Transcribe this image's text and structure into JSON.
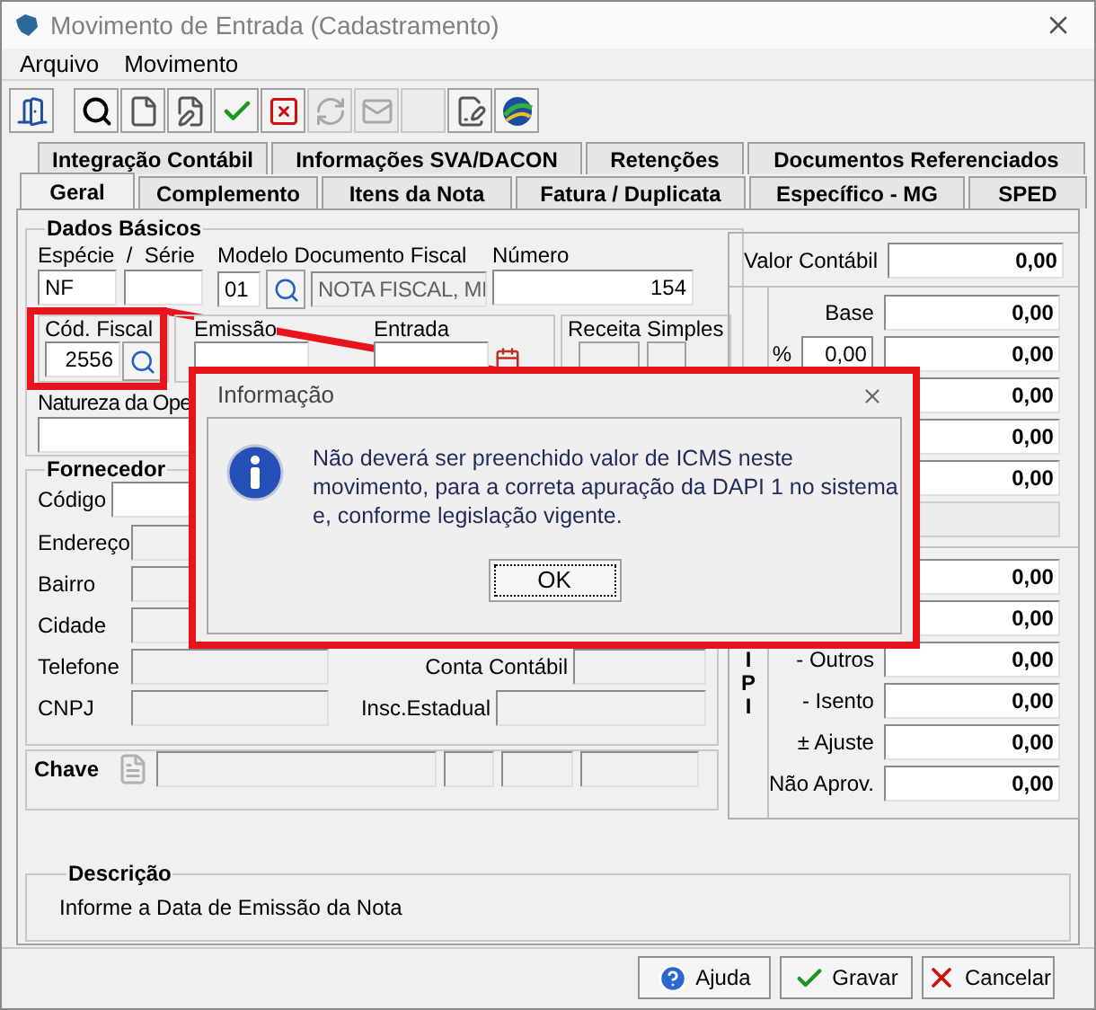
{
  "window": {
    "title": "Movimento de Entrada (Cadastramento)"
  },
  "menu": [
    {
      "label": "Arquivo"
    },
    {
      "label": "Movimento"
    }
  ],
  "toolbar": [
    {
      "kind": "exit",
      "disabled": false
    },
    {
      "kind": "search",
      "disabled": false
    },
    {
      "kind": "new",
      "disabled": false
    },
    {
      "kind": "edit",
      "disabled": false
    },
    {
      "kind": "confirm",
      "disabled": false
    },
    {
      "kind": "delete",
      "disabled": false
    },
    {
      "kind": "recycle",
      "disabled": true
    },
    {
      "kind": "mail",
      "disabled": true
    },
    {
      "kind": "blank",
      "disabled": true
    },
    {
      "kind": "sign",
      "disabled": false
    },
    {
      "kind": "nfe",
      "disabled": false
    }
  ],
  "tabs": [
    [
      {
        "label": "Integração Contábil",
        "selected": false
      },
      {
        "label": "Informações SVA/DACON",
        "selected": false
      },
      {
        "label": "Retenções",
        "selected": false
      },
      {
        "label": "Documentos Referenciados",
        "selected": false
      }
    ],
    [
      {
        "label": "Geral",
        "selected": true
      },
      {
        "label": "Complemento",
        "selected": false
      },
      {
        "label": "Itens da Nota",
        "selected": false
      },
      {
        "label": "Fatura / Duplicata",
        "selected": false
      },
      {
        "label": "Específico - MG",
        "selected": false
      },
      {
        "label": "SPED",
        "selected": false
      }
    ]
  ],
  "dados_basicos": {
    "title": "Dados Básicos",
    "especie_label": "Espécie  /  Série",
    "especie": {
      "value": "NF",
      "disabled": false
    },
    "serie": {
      "disabled": false
    },
    "modelo_label": "Modelo Documento Fiscal",
    "modelo": {
      "value": "01",
      "disabled": false
    },
    "modelo_desc": {
      "value": "NOTA FISCAL, MI",
      "disabled": true
    },
    "numero_label": "Número",
    "numero": {
      "value": "154",
      "disabled": false
    },
    "cod_fiscal_label": "Cód. Fiscal",
    "cod_fiscal": {
      "value": "2556",
      "disabled": false
    },
    "emissao_label": "Emissão",
    "emissao": {
      "disabled": false
    },
    "entrada_label": "Entrada",
    "entrada": {
      "disabled": false
    },
    "receita_label": "Receita Simples",
    "natureza_label": "Natureza da Ope",
    "natureza": {
      "disabled": false
    }
  },
  "fornecedor": {
    "title": "Fornecedor",
    "codigo_label": "Código",
    "codigo": {
      "disabled": false
    },
    "rows": [
      {
        "label": "Endereço",
        "disabled": true
      },
      {
        "label": "Bairro",
        "disabled": true
      },
      {
        "label": "Cidade",
        "disabled": true
      }
    ],
    "telefone_label": "Telefone",
    "conta_label": "Conta Contábil",
    "cnpj_label": "CNPJ",
    "insc_label": "Insc.Estadual"
  },
  "chave": {
    "label": "Chave"
  },
  "valores": {
    "valor_contabil_label": "Valor Contábil",
    "valor_contabil": "0,00",
    "icms": [
      {
        "label": "Base",
        "value": "0,00"
      },
      {
        "label": "%",
        "rate": "0,00",
        "value": "0,00"
      },
      {
        "value": "0,00"
      },
      {
        "value": "0,00"
      },
      {
        "value": "0,00"
      }
    ],
    "ipi_label": "I P I",
    "ipi": [
      {
        "value": "0,00"
      },
      {
        "value": "0,00"
      },
      {
        "label": "- Outros",
        "value": "0,00"
      },
      {
        "label": "- Isento",
        "value": "0,00"
      },
      {
        "label": "± Ajuste",
        "value": "0,00"
      },
      {
        "label": "Não Aprov.",
        "value": "0,00"
      }
    ]
  },
  "descricao": {
    "title": "Descrição",
    "text": "Informe a Data de Emissão da Nota"
  },
  "buttons": [
    {
      "kind": "help",
      "label": "Ajuda"
    },
    {
      "kind": "save",
      "label": "Gravar"
    },
    {
      "kind": "cancel",
      "label": "Cancelar"
    }
  ],
  "dialog": {
    "title": "Informação",
    "message": "Não deverá ser preenchido valor de ICMS neste movimento, para a correta apuração da DAPI 1 no sistema e, conforme legislação vigente.",
    "button": "OK"
  }
}
